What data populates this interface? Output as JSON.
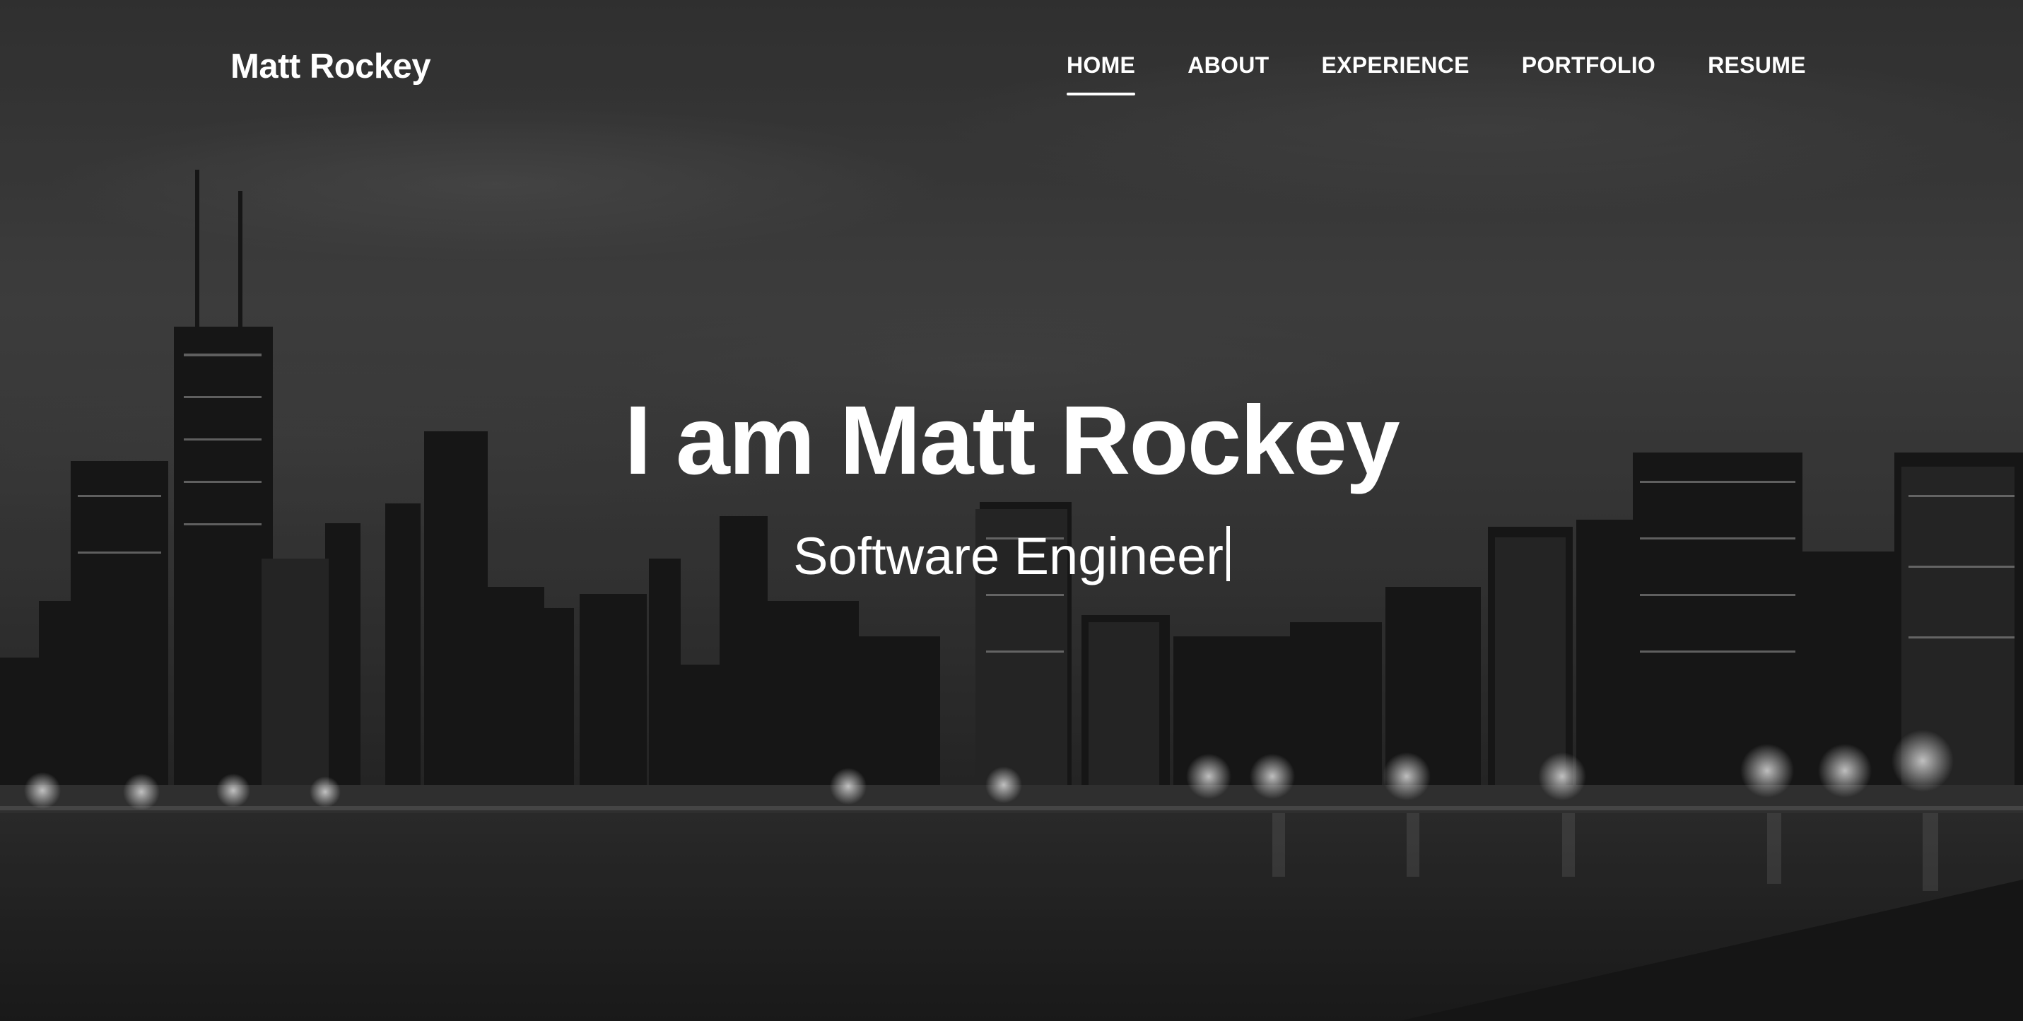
{
  "navbar": {
    "brand": "Matt Rockey",
    "links": [
      {
        "label": "HOME",
        "active": true
      },
      {
        "label": "ABOUT",
        "active": false
      },
      {
        "label": "EXPERIENCE",
        "active": false
      },
      {
        "label": "PORTFOLIO",
        "active": false
      },
      {
        "label": "RESUME",
        "active": false
      }
    ]
  },
  "hero": {
    "title": "I am Matt Rockey",
    "subtitle": "Software Engineer",
    "background_image": "city-skyline-night-grayscale"
  },
  "colors": {
    "text": "#ffffff",
    "background": "#3a3a3a"
  }
}
